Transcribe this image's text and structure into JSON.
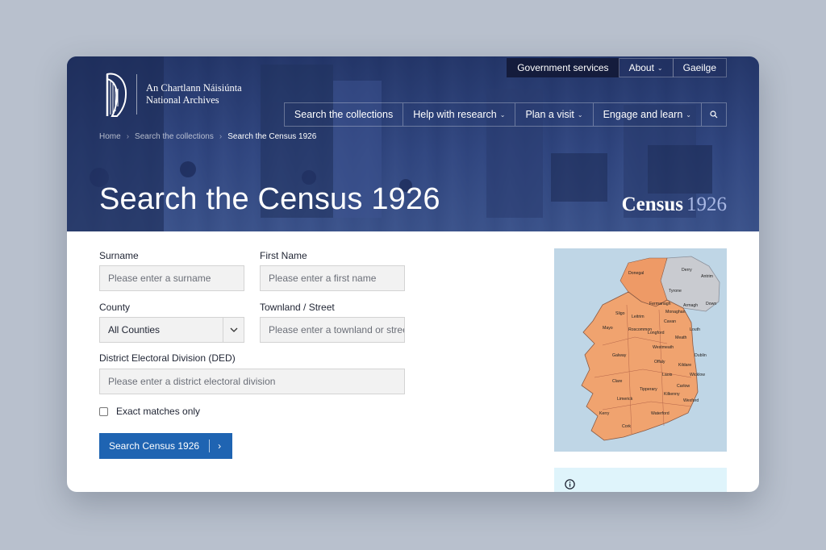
{
  "header": {
    "logo_irish": "An Chartlann Náisiúnta",
    "logo_english": "National Archives",
    "topnav": [
      {
        "label": "Government services"
      },
      {
        "label": "About"
      },
      {
        "label": "Gaeilge"
      }
    ],
    "mainnav": [
      {
        "label": "Search the collections"
      },
      {
        "label": "Help with research"
      },
      {
        "label": "Plan a visit"
      },
      {
        "label": "Engage and learn"
      }
    ]
  },
  "breadcrumb": [
    "Home",
    "Search the collections",
    "Search the Census 1926"
  ],
  "hero": {
    "title": "Search the Census 1926",
    "logo_word": "Census",
    "logo_year": "1926"
  },
  "form": {
    "surname_label": "Surname",
    "surname_placeholder": "Please enter a surname",
    "firstname_label": "First Name",
    "firstname_placeholder": "Please enter a first name",
    "county_label": "County",
    "county_value": "All Counties",
    "townland_label": "Townland / Street",
    "townland_placeholder": "Please enter a townland or street",
    "ded_label": "District Electoral Division (DED)",
    "ded_placeholder": "Please enter a district electoral division",
    "exact_label": "Exact matches only",
    "submit_label": "Search Census 1926"
  },
  "map": {
    "labels": [
      "Donegal",
      "Derry",
      "Antrim",
      "Tyrone",
      "Fermanagh",
      "Armagh",
      "Down",
      "Sligo",
      "Leitrim",
      "Monaghan",
      "Cavan",
      "Mayo",
      "Roscommon",
      "Longford",
      "Louth",
      "Meath",
      "Westmeath",
      "Galway",
      "Dublin",
      "Offaly",
      "Kildare",
      "Laois",
      "Wicklow",
      "Clare",
      "Tipperary",
      "Carlow",
      "Limerick",
      "Kilkenny",
      "Wexford",
      "Kerry",
      "Waterford",
      "Cork"
    ]
  },
  "colors": {
    "brand_navy": "#223466",
    "button_blue": "#1f64b2",
    "info_bg": "#dff4fb",
    "map_sea": "#bfd6e6",
    "map_land": "#f0a36f"
  }
}
